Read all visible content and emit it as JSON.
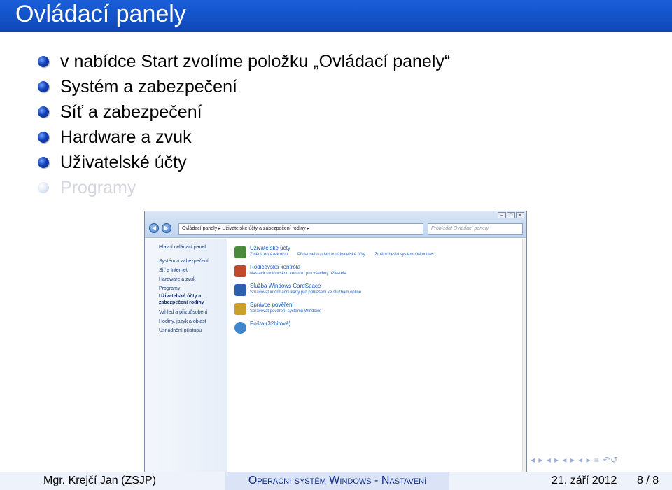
{
  "slide": {
    "title": "Ovládací panely",
    "bullets": [
      {
        "text": "v nabídce Start zvolíme položku „Ovládací panely“",
        "faded": false
      },
      {
        "text": "Systém a zabezpečení",
        "faded": false
      },
      {
        "text": "Síť a zabezpečení",
        "faded": false
      },
      {
        "text": "Hardware a zvuk",
        "faded": false
      },
      {
        "text": "Uživatelské účty",
        "faded": false
      },
      {
        "text": "Programy",
        "faded": true
      }
    ]
  },
  "window": {
    "address": "Ovládací panely  ▸  Uživatelské účty a zabezpečení rodiny  ▸",
    "search_placeholder": "Prohledat Ovládací panely",
    "controls": [
      "–",
      "□",
      "x"
    ],
    "sidebar": {
      "main": "Hlavní ovládací panel",
      "items": [
        "Systém a zabezpečení",
        "Síť a Internet",
        "Hardware a zvuk",
        "Programy",
        "Uživatelské účty a zabezpečení rodiny",
        "Vzhled a přizpůsobení",
        "Hodiny, jazyk a oblast",
        "Usnadnění přístupu"
      ],
      "current_item_lines": [
        "Uživatelské účty a",
        "zabezpečení rodiny"
      ]
    },
    "categories": [
      {
        "title": "Uživatelské účty",
        "icon_color": "#4b8a3c",
        "links": [
          "Změnit obrázek účtu",
          "Přidat nebo odebrat uživatelské účty",
          "Změnit heslo systému Windows"
        ]
      },
      {
        "title": "Rodičovská kontrola",
        "icon_color": "#c24a2a",
        "links": [
          "Nastavit rodičovskou kontrolu pro všechny uživatele"
        ]
      },
      {
        "title": "Služba Windows CardSpace",
        "icon_color": "#2d5fb0",
        "links": [
          "Spravovat informační karty pro přihlášení ke službám online"
        ]
      },
      {
        "title": "Správce pověření",
        "icon_color": "#c9a12a",
        "links": [
          "Spravovat pověření systému Windows"
        ]
      },
      {
        "title": "Pošta (32bitové)",
        "icon_color": "#3f86cf",
        "links": []
      }
    ]
  },
  "beamer_nav": "◂ ▸ ◂ ▸ ◂ ▸ ◂ ▸  ≡  ↶↺",
  "footer": {
    "author": "Mgr. Krejčí Jan (ZSJP)",
    "title": "Operační systém Windows - Nastavení",
    "date": "21. září 2012",
    "page": "8 / 8"
  }
}
